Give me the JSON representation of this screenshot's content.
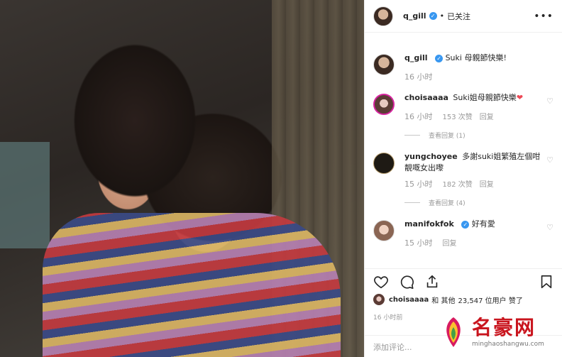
{
  "post": {
    "author": "q_gill",
    "follow_status": "已关注",
    "caption_user": "q_gill",
    "caption": "Suki 母親節快樂!",
    "caption_time": "16 小时"
  },
  "comments": [
    {
      "user": "choisaaaa",
      "text": "Suki姐母親節快樂",
      "time": "16 小时",
      "likes": "153 次赞",
      "reply": "回复",
      "view_replies": "查看回复 (1)"
    },
    {
      "user": "yungchoyee",
      "text": "多謝suki姐繁殖左個咁靚嘅女出嚟",
      "time": "15 小时",
      "likes": "182 次赞",
      "reply": "回复",
      "view_replies": "查看回复 (4)"
    },
    {
      "user": "manifokfok",
      "text": "好有愛",
      "time": "15 小时",
      "likes": "",
      "reply": "回复"
    }
  ],
  "likes_summary": {
    "first_user": "choisaaaa",
    "joiner": "和 其他",
    "count": "23,547 位用户 赞了"
  },
  "post_time": "16 小时前",
  "add_comment_placeholder": "添加评论...",
  "watermark": {
    "title": "名豪网",
    "url": "minghaoshangwu.com"
  },
  "icons": {
    "more": "more-icon",
    "verified": "verified-icon",
    "heart": "heart-icon",
    "comment": "comment-icon",
    "share": "share-icon",
    "save": "bookmark-icon"
  },
  "colors": {
    "verified": "#3897f0",
    "like_red": "#ed4956",
    "watermark_red": "#c9151e"
  }
}
